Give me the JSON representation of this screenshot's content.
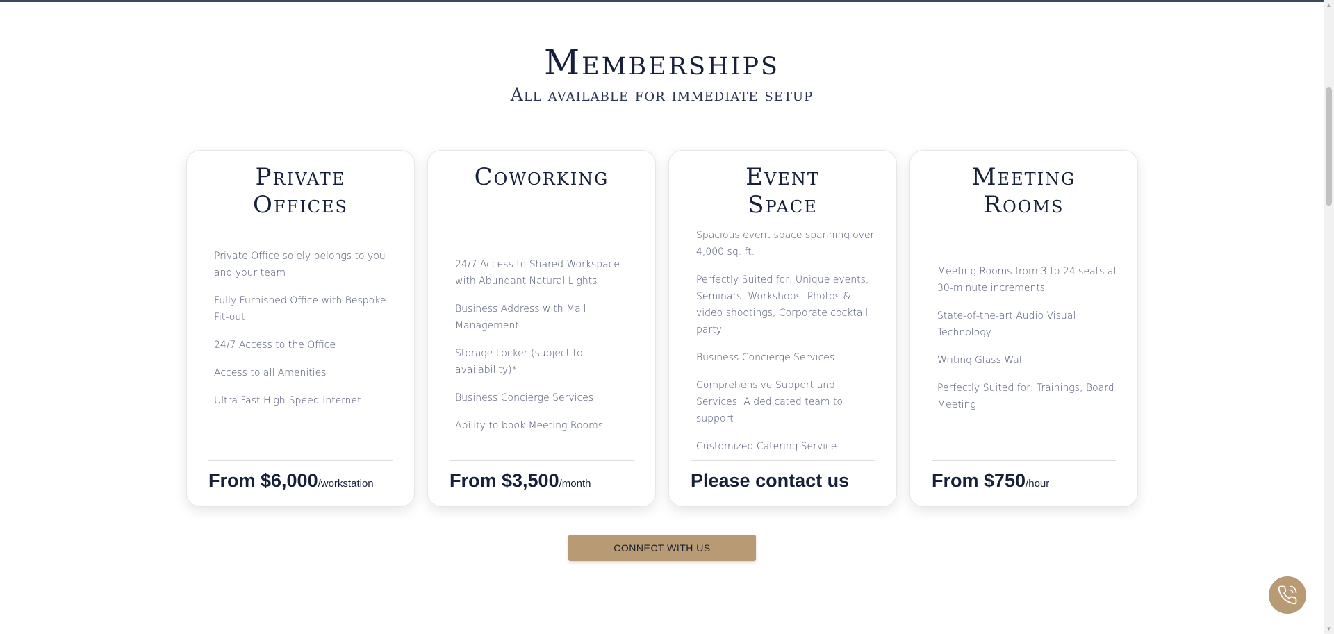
{
  "header": {
    "title": "Memberships",
    "subtitle": "All available for immediate setup"
  },
  "cards": [
    {
      "title_line1": "Private",
      "title_line2": "Offices",
      "features": [
        "Private Office solely belongs to you and your team",
        "Fully Furnished Office with Bespoke Fit-out",
        "24/7 Access to the Office",
        "Access to all Amenities",
        "Ultra Fast High-Speed Internet"
      ],
      "price_amount": "From $6,000",
      "price_unit": "/workstation"
    },
    {
      "title_line1": "Coworking",
      "title_line2": "",
      "features": [
        "24/7 Access to Shared Workspace with Abundant Natural Lights",
        "Business Address with Mail Management",
        "Storage Locker (subject to availability)*",
        "Business Concierge Services",
        "Ability to book Meeting Rooms"
      ],
      "price_amount": "From $3,500",
      "price_unit": "/month"
    },
    {
      "title_line1": "Event",
      "title_line2": "Space",
      "features": [
        "Spacious event space spanning over 4,000 sq. ft.",
        "Perfectly Suited for: Unique events, Seminars, Workshops, Photos & video shootings, Corporate cocktail party",
        "Business Concierge Services",
        "Comprehensive Support and Services: A dedicated team to support",
        "Customized Catering Service"
      ],
      "price_amount": "Please contact us",
      "price_unit": ""
    },
    {
      "title_line1": "Meeting",
      "title_line2": "Rooms",
      "features": [
        "Meeting Rooms from 3 to 24 seats at 30-minute increments",
        "State-of-the-art Audio Visual Technology",
        "Writing Glass Wall",
        "Perfectly Suited for: Trainings, Board Meeting"
      ],
      "price_amount": "From $750",
      "price_unit": "/hour"
    }
  ],
  "cta": {
    "label": "CONNECT WITH US"
  },
  "fab": {
    "icon": "phone-icon"
  },
  "colors": {
    "accent": "#b89a74",
    "navy": "#16203a"
  }
}
